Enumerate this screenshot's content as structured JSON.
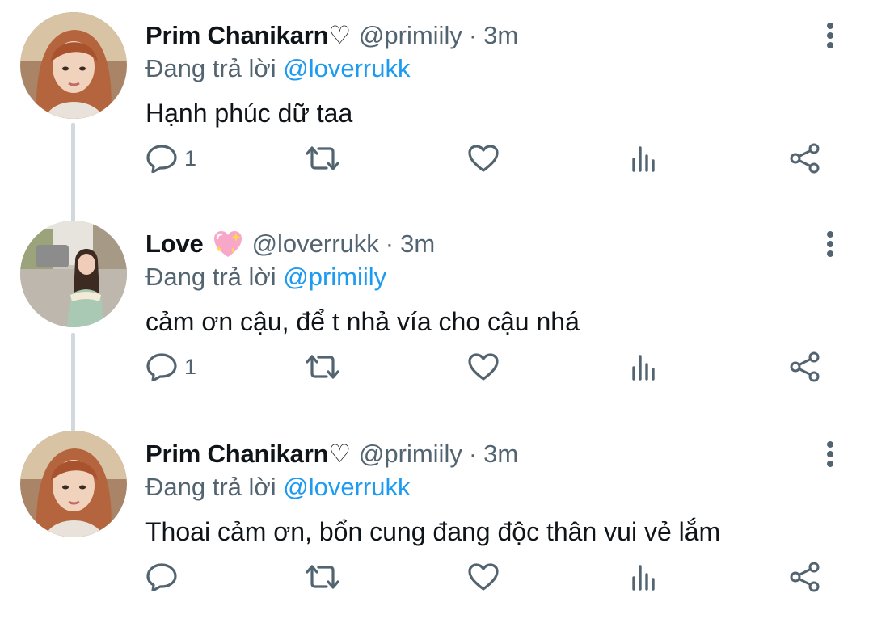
{
  "colors": {
    "text": "#0f1419",
    "secondary": "#536471",
    "mention": "#1d9bf0",
    "thread_line": "#cfd9de"
  },
  "tweets": [
    {
      "display_name": "Prim Chanikarn♡",
      "handle": "@primiily",
      "separator": "·",
      "time": "3m",
      "reply_prefix": "Đang trả lời",
      "reply_to": "@loverrukk",
      "text": "Hạnh phúc dữ taa",
      "reply_count": "1",
      "emoji": ""
    },
    {
      "display_name": "Love",
      "handle": "@loverrukk",
      "separator": "·",
      "time": "3m",
      "reply_prefix": "Đang trả lời",
      "reply_to": "@primiily",
      "text": "cảm ơn cậu, để t nhả vía cho cậu nhá",
      "reply_count": "1",
      "emoji": "sparkling-heart-icon"
    },
    {
      "display_name": "Prim Chanikarn♡",
      "handle": "@primiily",
      "separator": "·",
      "time": "3m",
      "reply_prefix": "Đang trả lời",
      "reply_to": "@loverrukk",
      "text": "Thoai cảm ơn, bổn cung đang độc thân vui vẻ lắm",
      "reply_count": "",
      "emoji": ""
    }
  ],
  "icons": {
    "reply": "reply-bubble-icon",
    "retweet": "retweet-icon",
    "like": "heart-icon",
    "views": "views-bar-chart-icon",
    "share": "share-icon",
    "more": "more-vertical-icon"
  }
}
